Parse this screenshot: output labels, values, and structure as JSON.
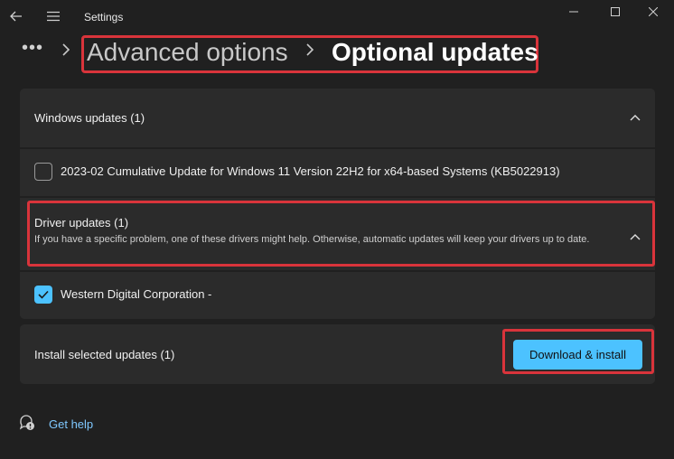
{
  "window": {
    "title": "Settings"
  },
  "breadcrumb": {
    "more": "•••",
    "parent": "Advanced options",
    "current": "Optional updates"
  },
  "windows_updates": {
    "header": "Windows updates (1)",
    "items": [
      {
        "label": "2023-02 Cumulative Update for Windows 11 Version 22H2 for x64-based Systems (KB5022913)",
        "checked": false
      }
    ]
  },
  "driver_updates": {
    "header": "Driver updates (1)",
    "description": "If you have a specific problem, one of these drivers might help. Otherwise, automatic updates will keep your drivers up to date.",
    "items": [
      {
        "label": "Western Digital Corporation -",
        "checked": true
      }
    ]
  },
  "install": {
    "label": "Install selected updates (1)",
    "button": "Download & install"
  },
  "help": {
    "label": "Get help"
  },
  "colors": {
    "accent": "#4cc2ff",
    "highlight_border": "#d9343b",
    "background": "#202020",
    "card": "#2b2b2b"
  },
  "icons": [
    "back-arrow-icon",
    "hamburger-menu-icon",
    "minimize-icon",
    "maximize-icon",
    "close-icon",
    "chevron-right-icon",
    "chevron-up-icon",
    "checkmark-icon",
    "help-chat-icon"
  ]
}
